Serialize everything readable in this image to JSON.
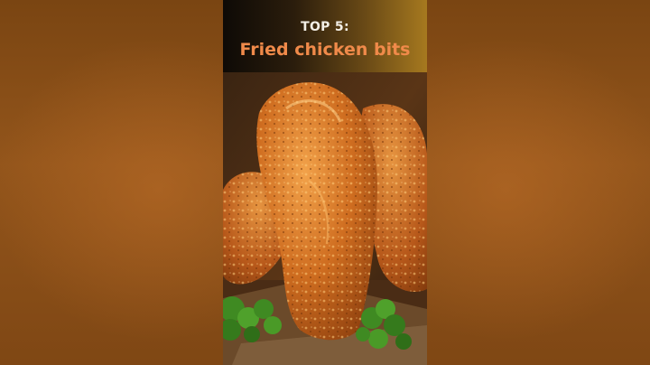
{
  "thumbnail": {
    "heading_small": "TOP 5:",
    "heading_main": "Fried chicken bits"
  },
  "colors": {
    "side_fill": "#8a4d15",
    "heading_small": "#f3efe6",
    "heading_main": "#f08a4a",
    "chicken_crust": "#c8681f",
    "parsley": "#3f8a22"
  }
}
